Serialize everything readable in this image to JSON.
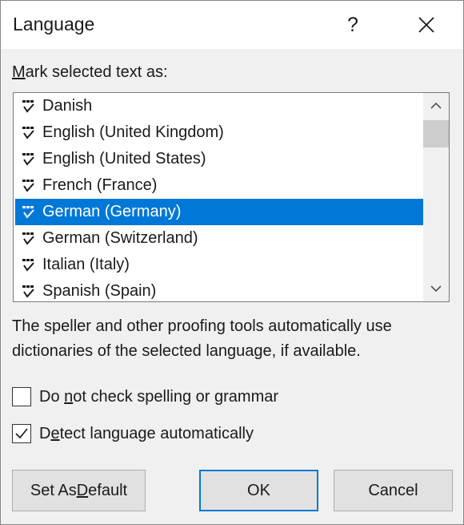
{
  "dialog": {
    "title": "Language",
    "help_label": "?",
    "close_icon": "close-icon"
  },
  "mark_label": {
    "pre": "",
    "accel": "M",
    "post": "ark selected text as:"
  },
  "languages": [
    {
      "label": "Danish",
      "selected": false
    },
    {
      "label": "English (United Kingdom)",
      "selected": false
    },
    {
      "label": "English (United States)",
      "selected": false
    },
    {
      "label": "French (France)",
      "selected": false
    },
    {
      "label": "German (Germany)",
      "selected": true
    },
    {
      "label": "German (Switzerland)",
      "selected": false
    },
    {
      "label": "Italian (Italy)",
      "selected": false
    },
    {
      "label": "Spanish (Spain)",
      "selected": false
    }
  ],
  "description": "The speller and other proofing tools automatically use dictionaries of the selected language, if available.",
  "options": {
    "no_check": {
      "pre": "Do ",
      "accel": "n",
      "post": "ot check spelling or grammar",
      "checked": false
    },
    "detect": {
      "pre": "D",
      "accel": "e",
      "post": "tect language automatically",
      "checked": true
    }
  },
  "buttons": {
    "set_default": {
      "pre": "Set As ",
      "accel": "D",
      "post": "efault"
    },
    "ok": "OK",
    "cancel": "Cancel"
  },
  "colors": {
    "selection": "#0078d7",
    "dialog_bg": "#f0f0f0"
  }
}
